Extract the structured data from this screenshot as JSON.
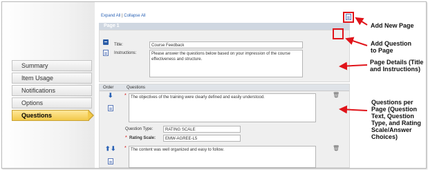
{
  "sidebar": {
    "items": [
      {
        "label": "Summary"
      },
      {
        "label": "Item Usage"
      },
      {
        "label": "Notifications"
      },
      {
        "label": "Options"
      },
      {
        "label": "Questions",
        "active": true
      }
    ]
  },
  "toolbar": {
    "expand_all": "Expand All",
    "separator": " | ",
    "collapse_all": "Collapse All"
  },
  "page": {
    "header": "Page 1",
    "title_label": "Title:",
    "title_value": "Course Feedback",
    "instructions_label": "Instructions:",
    "instructions_value": "Please answer the questions below based on your impression of the course effectiveness and structure."
  },
  "questions_table": {
    "col_order": "Order",
    "col_questions": "Questions",
    "rows": [
      {
        "required_mark": "*",
        "text": "The objectives of the training were clearly defined and easily understood.",
        "type_label": "Question Type:",
        "type_value": "RATING SCALE",
        "scale_label": "Rating Scale:",
        "scale_value": "EMW-AGREE-L5"
      },
      {
        "required_mark": "*",
        "text": "The content was well organized and easy to follow."
      }
    ]
  },
  "annotations": {
    "add_new_page": "Add New Page",
    "add_question": "Add Question to Page",
    "page_details": "Page Details (Title and Instructions)",
    "questions_per_page": "Questions per Page (Question Text, Question Type, and Rating Scale/Answer Choices)"
  },
  "colors": {
    "highlight": "#e0141a",
    "active_tab": "#f2c94a",
    "header_band": "#cfd7e1",
    "link": "#2a62b5"
  },
  "icons": [
    "add-page-icon",
    "add-question-icon",
    "trash-icon",
    "move-down-icon",
    "move-up-icon",
    "document-icon",
    "block-icon"
  ]
}
